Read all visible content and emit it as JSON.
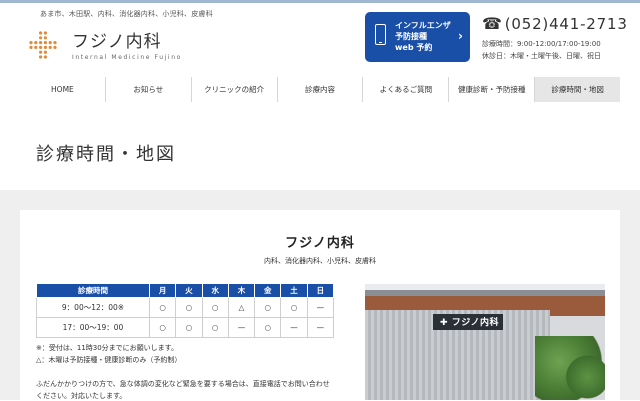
{
  "header": {
    "tagline": "あま市、木田駅、内科、消化器内科、小児科、皮膚科",
    "logo_name": "フジノ内科",
    "logo_sub": "Internal Medicine Fujino",
    "cta": {
      "line1": "インフルエンザ",
      "line2": "予防接種",
      "line3": "web 予約",
      "chevron": "›"
    },
    "phone": "(052)441-2713",
    "hours_line1": "診療時間：9:00-12:00/17:00-19:00",
    "hours_line2": "休診日：木曜・土曜午後、日曜、祝日"
  },
  "nav": {
    "items": [
      "HOME",
      "お知らせ",
      "クリニックの紹介",
      "診療内容",
      "よくあるご質問",
      "健康診断・予防接種",
      "診療時間・地図"
    ],
    "active_index": 6
  },
  "page": {
    "title": "診療時間・地図"
  },
  "clinic": {
    "name": "フジノ内科",
    "departments": "内科、消化器内科、小児科、皮膚科"
  },
  "schedule": {
    "headers": [
      "診療時間",
      "月",
      "火",
      "水",
      "木",
      "金",
      "土",
      "日"
    ],
    "rows": [
      [
        "9：00〜12：00※",
        "○",
        "○",
        "○",
        "△",
        "○",
        "○",
        "—"
      ],
      [
        "17：00〜19：00",
        "○",
        "○",
        "○",
        "—",
        "○",
        "—",
        "—"
      ]
    ]
  },
  "notes": {
    "n1": "※：受付は、11時30分までにお願いします。",
    "n2": "△：木曜は予防接種・健康診断のみ（予約制）",
    "n3": "ふだんかかりつけの方で、急な体調の変化など緊急を要する場合は、直接電話でお問い合わせ",
    "n4": "ください。対応いたします。"
  },
  "photo": {
    "sign": "フジノ内科",
    "sign_mark": "✚"
  },
  "icons": {
    "phone": "phone-icon",
    "smartphone": "smartphone-icon",
    "logo": "cross-dots-logo-icon"
  },
  "colors": {
    "accent": "#1a4fa8",
    "logo": "#e08a3a"
  }
}
